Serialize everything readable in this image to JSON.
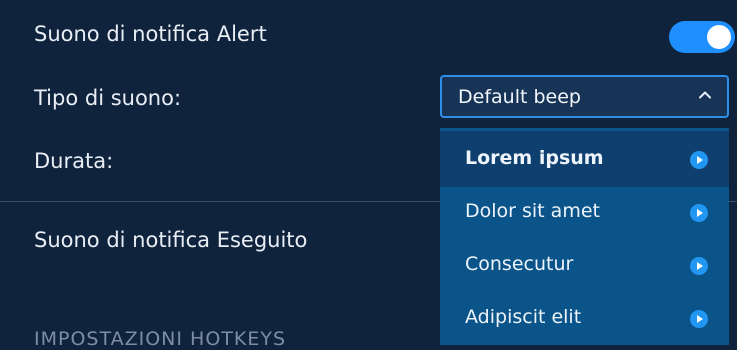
{
  "settings": {
    "alert_sound_label": "Suono di notifica Alert",
    "sound_type_label": "Tipo di suono:",
    "duration_label": "Durata:",
    "executed_sound_label": "Suono di notifica Eseguito",
    "hotkeys_section_header": "IMPOSTAZIONI HOTKEYS"
  },
  "toggle": {
    "on": true
  },
  "sound_select": {
    "value": "Default beep",
    "options": [
      {
        "label": "Lorem ipsum",
        "active": true
      },
      {
        "label": "Dolor sit amet",
        "active": false
      },
      {
        "label": "Consecutur",
        "active": false
      },
      {
        "label": "Adipiscit elit",
        "active": false
      }
    ]
  },
  "icons": {
    "toggle": "toggle-switch",
    "chevron": "chevron-up-icon",
    "play": "play-circle-icon"
  },
  "colors": {
    "background": "#0f233d",
    "accent": "#1f8fff",
    "dropdown_bg": "#0a5489",
    "dropdown_active": "#0e3f6e"
  }
}
